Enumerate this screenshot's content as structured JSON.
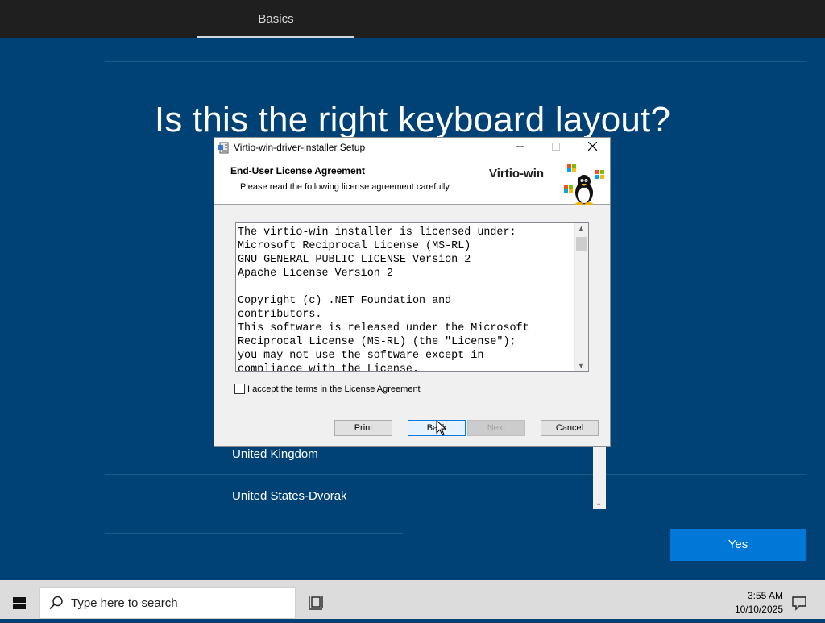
{
  "oobe": {
    "tab_label": "Basics",
    "title": "Is this the right keyboard layout?",
    "layouts": [
      "United Kingdom",
      "United States-Dvorak"
    ],
    "yes_label": "Yes"
  },
  "dialog": {
    "title": "Virtio-win-driver-installer Setup",
    "heading": "End-User License Agreement",
    "subheading": "Please read the following license agreement carefully",
    "brand": "Virtio-win",
    "license_text": "The virtio-win installer is licensed under:\nMicrosoft Reciprocal License (MS-RL)\nGNU GENERAL PUBLIC LICENSE Version 2\nApache License Version 2\n\nCopyright (c) .NET Foundation and\ncontributors.\nThis software is released under the Microsoft\nReciprocal License (MS-RL) (the \"License\");\nyou may not use the software except in\ncompliance with the License.",
    "accept_label": "I accept the terms in the License Agreement",
    "accept_checked": false,
    "buttons": {
      "print": "Print",
      "back": "Back",
      "next": "Next",
      "cancel": "Cancel"
    }
  },
  "taskbar": {
    "search_placeholder": "Type here to search",
    "time": "3:55 AM",
    "date": "10/10/2025"
  },
  "colors": {
    "oobe_background": "#004275",
    "accent": "#0078d7"
  }
}
